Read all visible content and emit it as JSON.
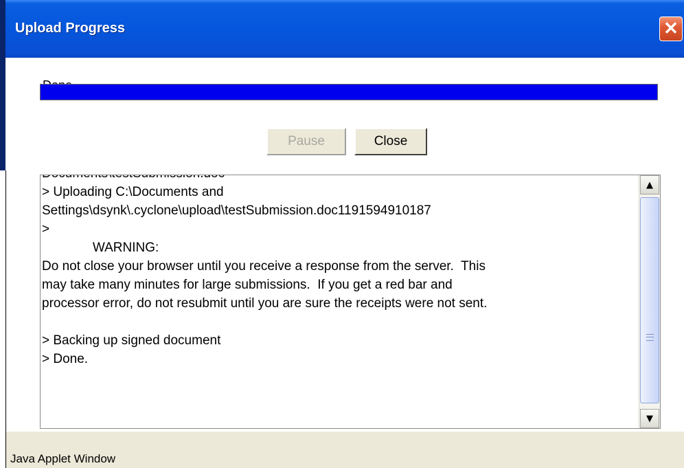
{
  "window": {
    "title": "Upload Progress",
    "close_symbol": "✕"
  },
  "status": {
    "text": "Done.",
    "progress_fraction": 1.0,
    "progress_color": "#0000ee"
  },
  "buttons": {
    "pause_label": "Pause",
    "close_label": "Close"
  },
  "log": {
    "lines": [
      "Documents\\testSubmission.doc",
      "> Uploading C:\\Documents and",
      "Settings\\dsynk\\.cyclone\\upload\\testSubmission.doc1191594910187",
      ">",
      "              WARNING:",
      "Do not close your browser until you receive a response from the server.  This",
      "may take many minutes for large submissions.  If you get a red bar and",
      "processor error, do not resubmit until you are sure the receipts were not sent.",
      "",
      "> Backing up signed document",
      "> Done."
    ]
  },
  "footer": {
    "label": "Java Applet Window"
  }
}
